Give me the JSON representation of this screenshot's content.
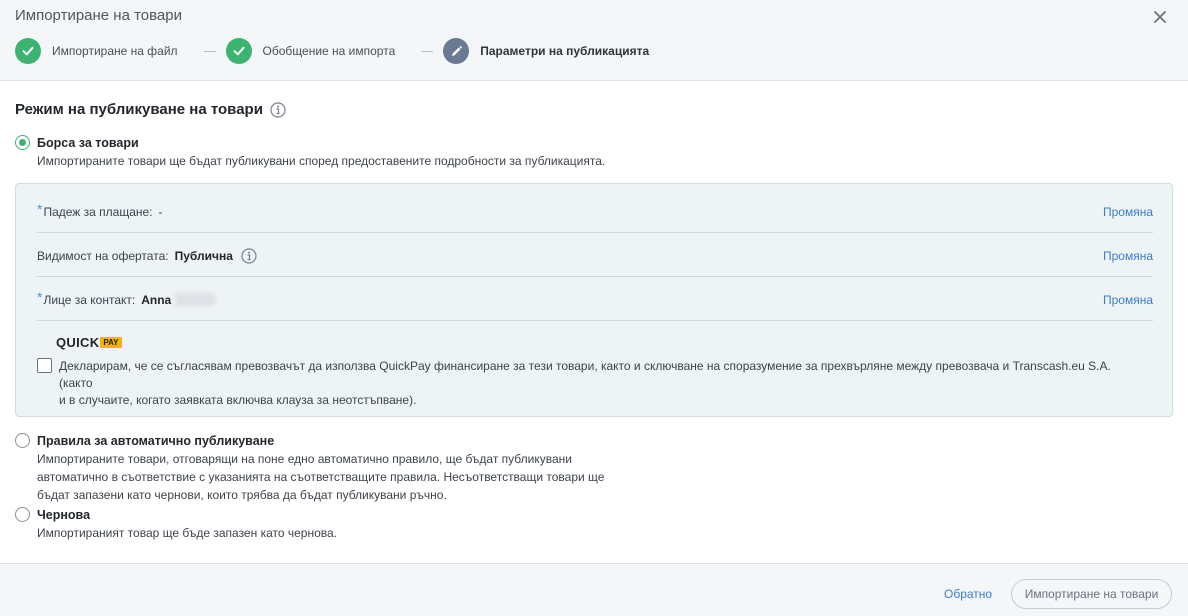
{
  "modal": {
    "title": "Импортиране на товари",
    "close_icon": "close-icon"
  },
  "steps": [
    {
      "label": "Импортиране на файл",
      "status": "done",
      "icon": "check-icon"
    },
    {
      "label": "Обобщение на импорта",
      "status": "done",
      "icon": "check-icon"
    },
    {
      "label": "Параметри на публикацията",
      "status": "current",
      "icon": "pencil-icon"
    }
  ],
  "section": {
    "title": "Режим на публикуване на товари",
    "icon": "info-icon"
  },
  "options": {
    "exchange": {
      "label": "Борса за товари",
      "description": "Импортираните товари ще бъдат публикувани според предоставените подробности за публикацията.",
      "selected": true
    },
    "auto_rules": {
      "label": "Правила за автоматично публикуване",
      "description_lines": [
        "Импортираните товари, отговарящи на поне едно автоматично правило, ще бъдат публикувани",
        "автоматично в съответствие с указанията на съответстващите правила. Несъответстващи товари ще",
        "бъдат запазени като чернови, които трябва да бъдат публикувани ръчно."
      ],
      "selected": false
    },
    "draft": {
      "label": "Чернова",
      "description": "Импортираният товар ще бъде запазен като чернова.",
      "selected": false
    }
  },
  "panel": {
    "payment": {
      "required_mark": "*",
      "label": "Падеж за плащане:",
      "value": "-",
      "link": "Промяна"
    },
    "visibility": {
      "label": "Видимост на офертата:",
      "value": "Публична",
      "link": "Промяна"
    },
    "contact": {
      "required_mark": "*",
      "label": "Лице за контакт:",
      "value": "Anna",
      "link": "Промяна"
    },
    "quickpay": {
      "brand": "QUICK",
      "badge": "PAY",
      "declaration_lines": [
        "Декларирам, че се съгласявам превозвачът да използва QuickPay финансиране за тези товари, както и сключване на споразумение за прехвърляне между превозвача и Transcash.eu S.A. (както",
        "и в случаите, когато заявката включва клауза за неотстъпване)."
      ],
      "checked": false
    }
  },
  "footer": {
    "back_label": "Обратно",
    "import_label": "Импортиране на товари"
  },
  "colors": {
    "success": "#3cb371",
    "current_step": "#6b7a93",
    "link": "#3a7dc9",
    "required": "#4a90d9",
    "quickpay_badge": "#f4b400"
  }
}
